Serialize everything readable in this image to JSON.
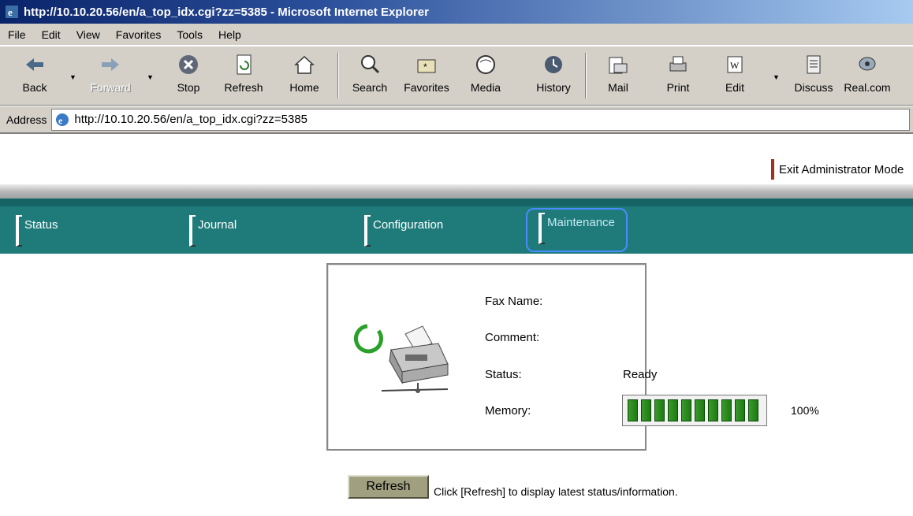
{
  "window": {
    "title": "http://10.10.20.56/en/a_top_idx.cgi?zz=5385 - Microsoft Internet Explorer"
  },
  "menu": [
    "File",
    "Edit",
    "View",
    "Favorites",
    "Tools",
    "Help"
  ],
  "toolbar": {
    "back": "Back",
    "forward": "Forward",
    "stop": "Stop",
    "refresh": "Refresh",
    "home": "Home",
    "search": "Search",
    "favorites": "Favorites",
    "media": "Media",
    "history": "History",
    "mail": "Mail",
    "print": "Print",
    "edit": "Edit",
    "discuss": "Discuss",
    "real": "Real.com"
  },
  "address": {
    "label": "Address",
    "url": "http://10.10.20.56/en/a_top_idx.cgi?zz=5385"
  },
  "page": {
    "exit_link": "Exit Administrator Mode",
    "nav": {
      "status": "Status",
      "journal": "Journal",
      "configuration": "Configuration",
      "maintenance": "Maintenance"
    },
    "info": {
      "fax_name_label": "Fax Name:",
      "comment_label": "Comment:",
      "status_label": "Status:",
      "status_value": "Ready",
      "memory_label": "Memory:",
      "memory_percent": "100%",
      "memory_level": 1.0
    },
    "refresh_button": "Refresh",
    "refresh_note": "Click [Refresh] to display latest status/information."
  },
  "colors": {
    "nav_bg": "#1f7a7a",
    "title_bar": "#0a246a",
    "meter_green": "#2a8a1e"
  }
}
